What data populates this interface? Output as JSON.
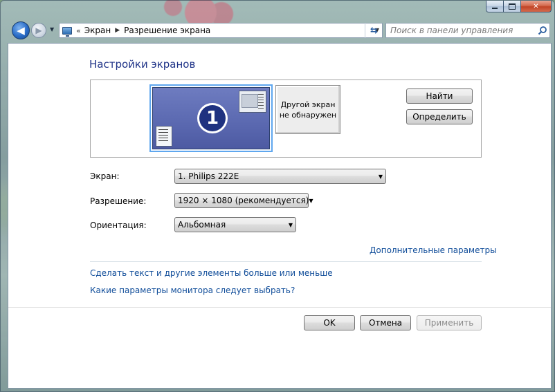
{
  "navigation": {
    "breadcrumbs": [
      "Экран",
      "Разрешение экрана"
    ],
    "overflow_glyph": "«",
    "search_placeholder": "Поиск в панели управления"
  },
  "page": {
    "title": "Настройки экранов"
  },
  "monitors": {
    "primary_number": "1",
    "secondary_label_line1": "Другой экран",
    "secondary_label_line2": "не обнаружен",
    "find_button": "Найти",
    "identify_button": "Определить"
  },
  "settings": {
    "display_label": "Экран:",
    "display_value": "1. Philips 222E",
    "resolution_label": "Разрешение:",
    "resolution_value": "1920 × 1080 (рекомендуется)",
    "orientation_label": "Ориентация:",
    "orientation_value": "Альбомная"
  },
  "links": {
    "advanced": "Дополнительные параметры",
    "text_size": "Сделать текст и другие элементы больше или меньше",
    "which_settings": "Какие параметры монитора следует выбрать?"
  },
  "footer": {
    "ok": "OK",
    "cancel": "Отмена",
    "apply": "Применить"
  }
}
